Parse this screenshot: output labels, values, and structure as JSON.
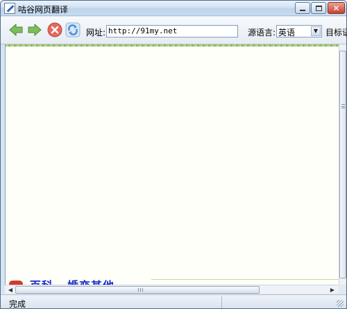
{
  "window": {
    "title": "咕谷网页翻译"
  },
  "toolbar": {
    "url_label": "网址:",
    "url_value": "http://91my.net",
    "source_lang_label": "源语言:",
    "source_lang_value": "英语",
    "target_lang_label": "目标语"
  },
  "content": {
    "banner_text": "百科 · 婚恋其他"
  },
  "statusbar": {
    "status_text": "完成"
  },
  "icons": {
    "back": "back-arrow-icon",
    "forward": "forward-arrow-icon",
    "stop": "stop-icon",
    "refresh": "refresh-icon"
  },
  "colors": {
    "nav_arrow": "#7cbf5a",
    "stop": "#e26a5e",
    "refresh": "#4f8fd6",
    "banner_text": "#1b2bc8"
  }
}
